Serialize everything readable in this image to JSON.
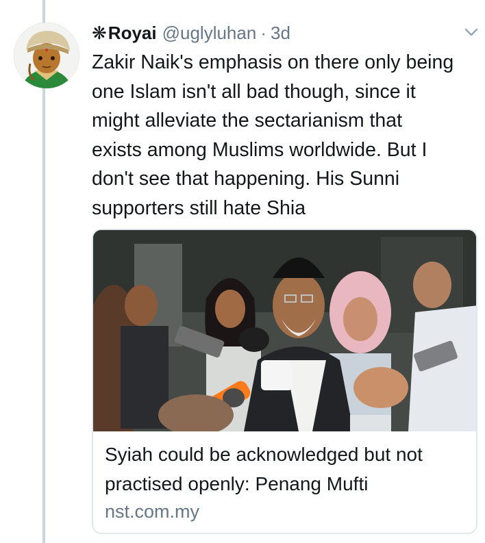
{
  "tweet": {
    "name_glyph": "❋",
    "display_name": "Royai",
    "handle": "@uglyluhan",
    "separator": "·",
    "time": "3d",
    "avatar_icon": "avatar-illustration-icon",
    "menu_icon": "chevron-down-icon",
    "text": "Zakir Naik's emphasis on there only being\none Islam isn't all bad though, since it\nmight alleviate the sectarianism that\nexists among Muslims worldwide. But I\ndon't see that happening. His Sunni\nsupporters still hate Shia"
  },
  "card": {
    "image_icon": "news-photo-icon",
    "title": "Syiah could be acknowledged but not\npractised openly: Penang Mufti",
    "domain": "nst.com.my"
  },
  "colors": {
    "text": "#14171a",
    "secondary": "#657786",
    "thread_line": "#ccd6dd",
    "card_border": "#e1e8ed"
  }
}
